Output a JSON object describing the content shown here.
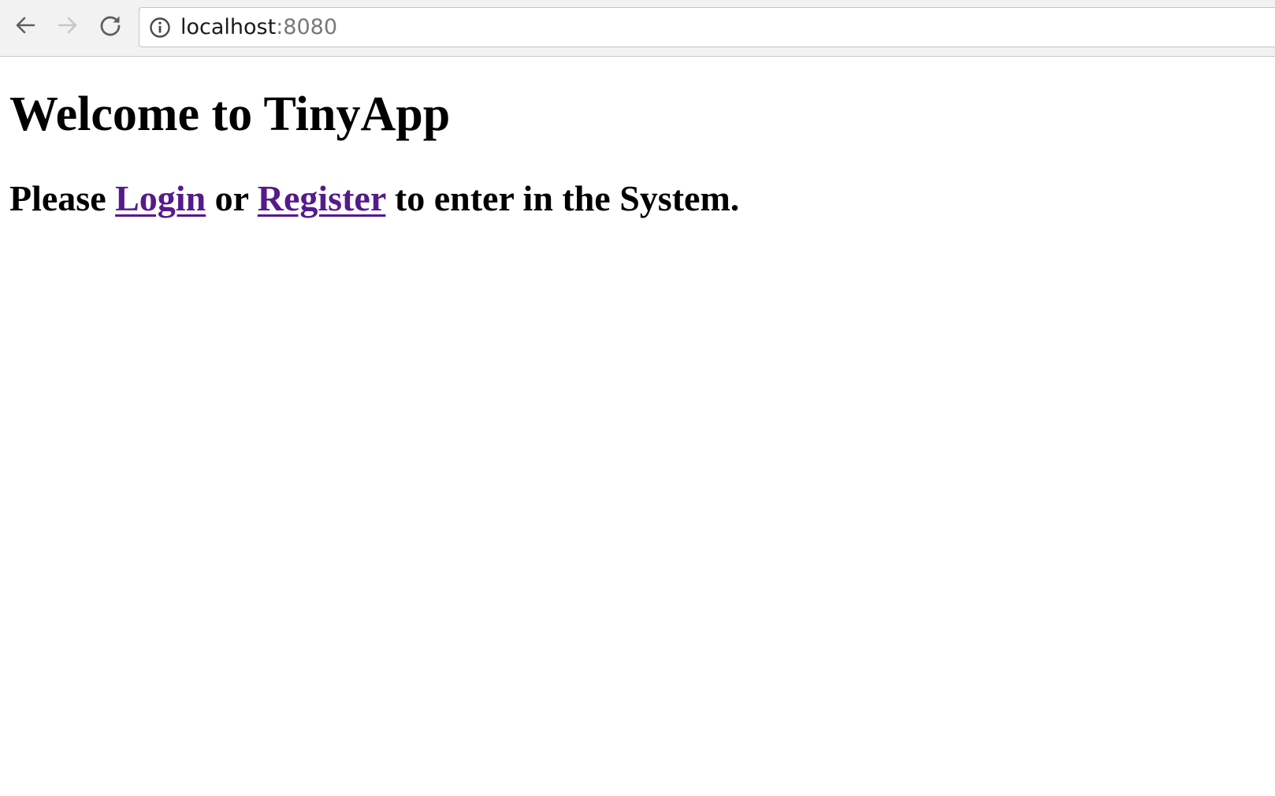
{
  "browser": {
    "url_host": "localhost",
    "url_port": ":8080",
    "icons": {
      "back": "back-arrow-icon",
      "forward": "forward-arrow-icon",
      "reload": "reload-icon",
      "info": "info-icon"
    }
  },
  "page": {
    "title": "Welcome to TinyApp",
    "prompt": {
      "before": "Please ",
      "login_link": "Login",
      "middle": " or ",
      "register_link": "Register",
      "after": " to enter in the System."
    }
  },
  "colors": {
    "visited_link": "#551a8b",
    "toolbar_bg": "#f2f2f2"
  }
}
